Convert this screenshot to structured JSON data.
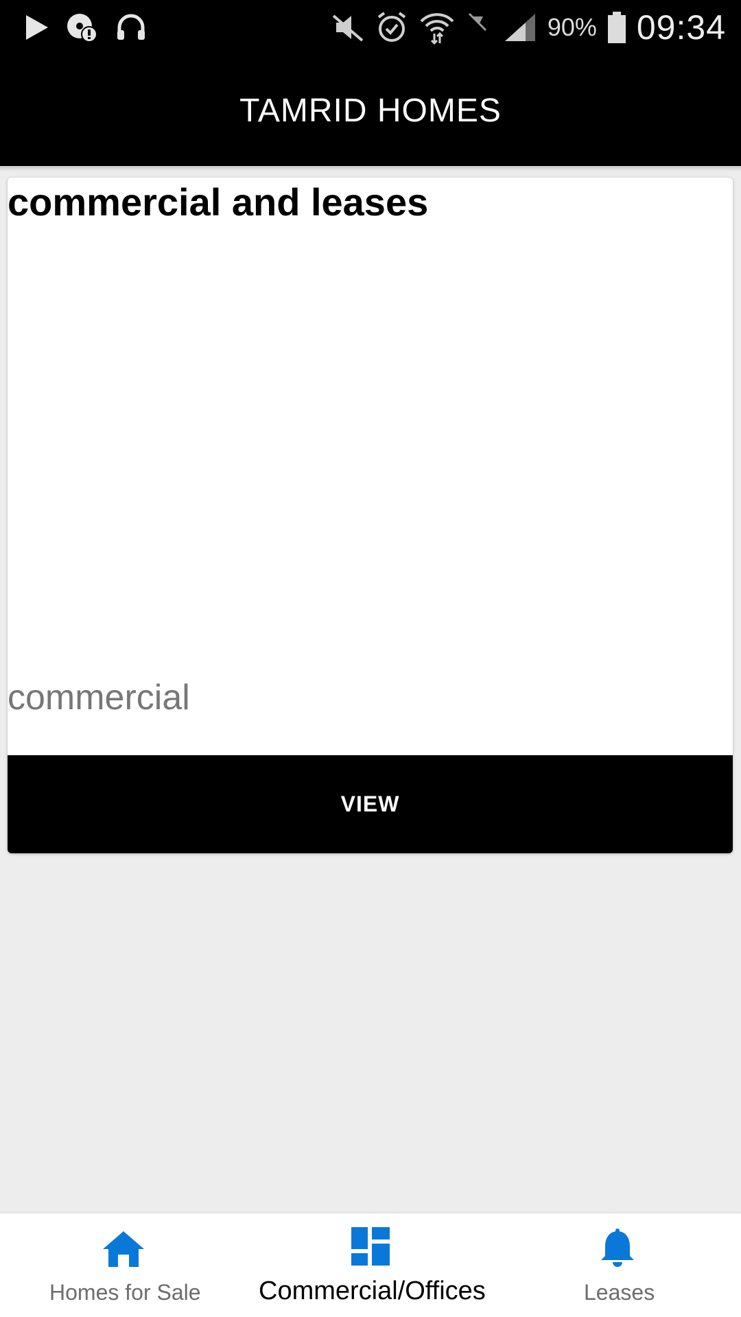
{
  "status_bar": {
    "battery_pct": "90%",
    "time": "09:34",
    "icons": [
      "play-icon",
      "notification-alert-icon",
      "headset-icon",
      "mute-icon",
      "alarm-icon",
      "wifi-icon",
      "no-signal-icon",
      "cell-signal-icon",
      "battery-icon"
    ]
  },
  "app_bar": {
    "title": "TAMRID HOMES"
  },
  "card": {
    "title": "commercial and leases",
    "subtitle": "commercial",
    "button_label": "VIEW"
  },
  "bottom_nav": {
    "items": [
      {
        "label": "Homes for Sale",
        "icon": "home-icon",
        "active": false
      },
      {
        "label": "Commercial/Offices",
        "icon": "dashboard-icon",
        "active": true
      },
      {
        "label": "Leases",
        "icon": "bell-icon",
        "active": false
      }
    ],
    "accent_color": "#0a78d8"
  }
}
